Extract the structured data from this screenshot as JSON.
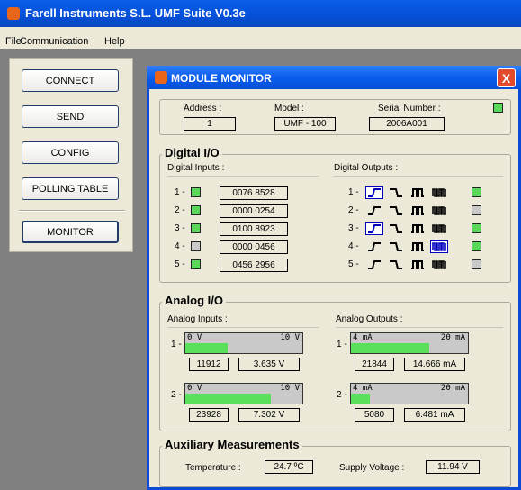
{
  "app": {
    "title": "Farell Instruments S.L.   UMF Suite   V0.3e",
    "menu": [
      "File",
      "Communication",
      "Help"
    ]
  },
  "nav": {
    "connect": "CONNECT",
    "send": "SEND",
    "config": "CONFIG",
    "polling": "POLLING TABLE",
    "monitor": "MONITOR"
  },
  "monitor": {
    "title": "MODULE MONITOR",
    "close": "X",
    "header": {
      "address_label": "Address :",
      "address_value": "1",
      "model_label": "Model :",
      "model_value": "UMF - 100",
      "serial_label": "Serial Number :",
      "serial_value": "2006A001"
    },
    "digital": {
      "title": "Digital I/O",
      "inputs_label": "Digital Inputs :",
      "outputs_label": "Digital Outputs :",
      "inputs": [
        {
          "n": "1 -",
          "value": "0076 8528",
          "state": "on"
        },
        {
          "n": "2 -",
          "value": "0000 0254",
          "state": "on"
        },
        {
          "n": "3 -",
          "value": "0100 8923",
          "state": "on"
        },
        {
          "n": "4 -",
          "value": "0000 0456",
          "state": "off"
        },
        {
          "n": "5 -",
          "value": "0456 2956",
          "state": "on"
        }
      ],
      "outputs": [
        {
          "n": "1 -",
          "mode": "rising",
          "state": "on"
        },
        {
          "n": "2 -",
          "mode": "none",
          "state": "off"
        },
        {
          "n": "3 -",
          "mode": "rising",
          "state": "on"
        },
        {
          "n": "4 -",
          "mode": "pwm",
          "state": "on"
        },
        {
          "n": "5 -",
          "mode": "none",
          "state": "off"
        }
      ]
    },
    "analog": {
      "title": "Analog I/O",
      "inputs_label": "Analog Inputs :",
      "outputs_label": "Analog Outputs :",
      "inputs": [
        {
          "n": "1 -",
          "lo": "0 V",
          "hi": "10 V",
          "level": 0.36,
          "raw": "11912",
          "value": "3.635 V"
        },
        {
          "n": "2 -",
          "lo": "0 V",
          "hi": "10 V",
          "level": 0.73,
          "raw": "23928",
          "value": "7.302 V"
        }
      ],
      "outputs": [
        {
          "n": "1 -",
          "lo": "4 mA",
          "hi": "20 mA",
          "level": 0.67,
          "raw": "21844",
          "value": "14.666 mA"
        },
        {
          "n": "2 -",
          "lo": "4 mA",
          "hi": "20 mA",
          "level": 0.16,
          "raw": "5080",
          "value": "6.481 mA"
        }
      ]
    },
    "aux": {
      "title": "Auxiliary Measurements",
      "temp_label": "Temperature :",
      "temp_value": "24.7 ºC",
      "volt_label": "Supply Voltage :",
      "volt_value": "11.94 V"
    }
  }
}
